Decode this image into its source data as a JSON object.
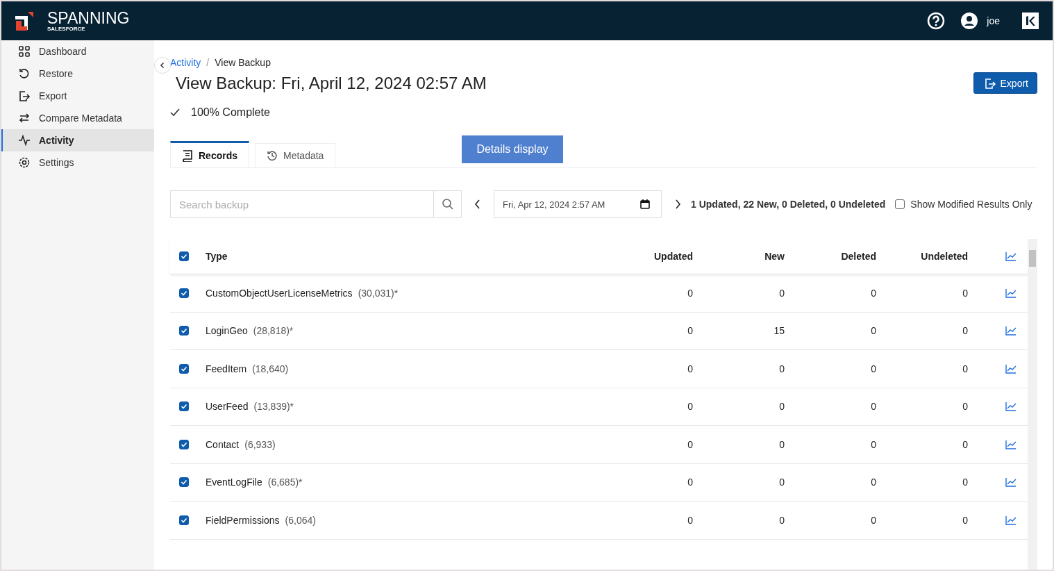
{
  "header": {
    "brand": "SPANNING",
    "brand_sub": "SALESFORCE",
    "user": "joe"
  },
  "sidebar": {
    "items": [
      {
        "label": "Dashboard",
        "selected": false
      },
      {
        "label": "Restore",
        "selected": false
      },
      {
        "label": "Export",
        "selected": false
      },
      {
        "label": "Compare Metadata",
        "selected": false
      },
      {
        "label": "Activity",
        "selected": true
      },
      {
        "label": "Settings",
        "selected": false
      }
    ]
  },
  "breadcrumb": {
    "parent": "Activity",
    "separator": "/",
    "current": "View Backup"
  },
  "title": "View Backup: Fri, April 12, 2024 02:57 AM",
  "export_button": "Export",
  "status": "100% Complete",
  "tabs": [
    {
      "label": "Records",
      "selected": true
    },
    {
      "label": "Metadata",
      "selected": false
    }
  ],
  "details_button": "Details display",
  "search": {
    "placeholder": "Search backup"
  },
  "date_field": {
    "value": "Fri, Apr 12, 2024 2:57 AM"
  },
  "summary": "1 Updated, 22 New, 0 Deleted, 0 Undeleted",
  "modified_only": {
    "label": "Show Modified Results Only",
    "checked": false
  },
  "table": {
    "all_checked": true,
    "columns": [
      "Type",
      "Updated",
      "New",
      "Deleted",
      "Undeleted"
    ],
    "rows": [
      {
        "type": "CustomObjectUserLicenseMetrics",
        "count": "(30,031)*",
        "updated": "0",
        "new": "0",
        "deleted": "0",
        "undeleted": "0",
        "checked": true
      },
      {
        "type": "LoginGeo",
        "count": "(28,818)*",
        "updated": "0",
        "new": "15",
        "deleted": "0",
        "undeleted": "0",
        "checked": true
      },
      {
        "type": "FeedItem",
        "count": "(18,640)",
        "updated": "0",
        "new": "0",
        "deleted": "0",
        "undeleted": "0",
        "checked": true
      },
      {
        "type": "UserFeed",
        "count": "(13,839)*",
        "updated": "0",
        "new": "0",
        "deleted": "0",
        "undeleted": "0",
        "checked": true
      },
      {
        "type": "Contact",
        "count": "(6,933)",
        "updated": "0",
        "new": "0",
        "deleted": "0",
        "undeleted": "0",
        "checked": true
      },
      {
        "type": "EventLogFile",
        "count": "(6,685)*",
        "updated": "0",
        "new": "0",
        "deleted": "0",
        "undeleted": "0",
        "checked": true
      },
      {
        "type": "FieldPermissions",
        "count": "(6,064)",
        "updated": "0",
        "new": "0",
        "deleted": "0",
        "undeleted": "0",
        "checked": true
      }
    ]
  }
}
